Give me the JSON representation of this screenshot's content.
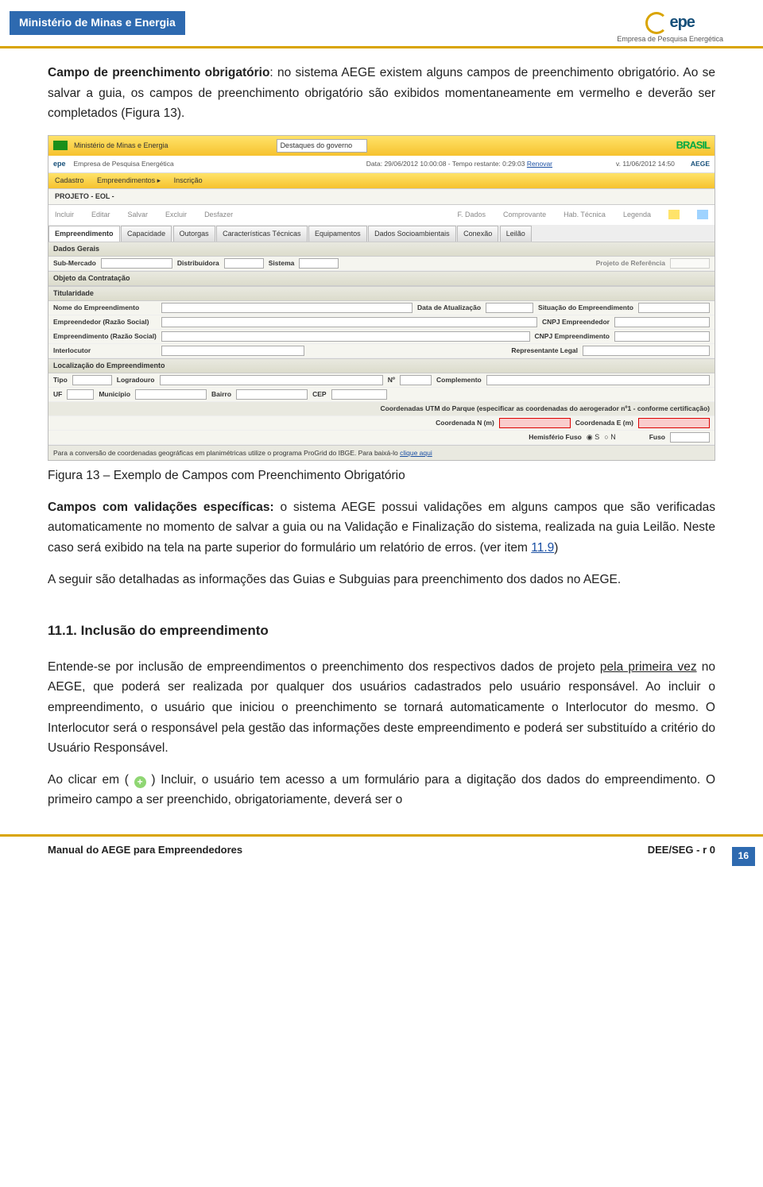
{
  "header": {
    "ministry": "Ministério de Minas e Energia",
    "logo_text": "epe",
    "logo_sub": "Empresa de Pesquisa Energética"
  },
  "para1_lead": "Campo de preenchimento obrigatório",
  "para1_rest": ": no sistema AEGE existem alguns campos de preenchimento obrigatório. Ao se salvar a guia, os campos de preenchimento obrigatório são exibidos momentaneamente em vermelho e deverão ser completados (Figura 13).",
  "caption": "Figura 13 – Exemplo de Campos com Preenchimento Obrigatório",
  "para2_lead": "Campos com validações específicas:",
  "para2_rest": " o sistema AEGE possui validações em alguns campos que são verificadas automaticamente no momento de salvar a guia ou na Validação e Finalização do sistema, realizada na guia Leilão. Neste caso será exibido na tela na parte superior do formulário um relatório de erros. (ver item ",
  "para2_link": "11.9",
  "para2_tail": ")",
  "para3": "A seguir são detalhadas as informações das Guias e Subguias para preenchimento dos dados no AEGE.",
  "section_heading": "11.1. Inclusão do empreendimento",
  "para4_a": "Entende-se por inclusão de empreendimentos o preenchimento dos respectivos dados de projeto ",
  "para4_u": "pela primeira vez",
  "para4_b": " no AEGE, que poderá ser realizada por qualquer dos usuários cadastrados pelo usuário responsável. Ao incluir o empreendimento, o usuário que iniciou o preenchimento se tornará automaticamente o Interlocutor do mesmo. O Interlocutor será o responsável pela gestão das informações deste empreendimento e poderá ser substituído a critério do Usuário Responsável.",
  "para5_a": "Ao clicar em ( ",
  "para5_b": " ) Incluir, o usuário tem acesso a um formulário para a digitação dos dados do empreendimento. O primeiro campo a ser preenchido, obrigatoriamente, deverá ser o",
  "page_number": "16",
  "footer_left": "Manual do AEGE para Empreendedores",
  "footer_right": "DEE/SEG - r 0",
  "shot": {
    "gov_label": "Ministério de Minas e Energia",
    "destaques": "Destaques do governo",
    "brasil": "BRASIL",
    "epe": "epe",
    "epe_sub": "Empresa de Pesquisa Energética",
    "data_line": "Data: 29/06/2012 10:00:08 - Tempo restante: 0:29:03 ",
    "renovar": "Renovar",
    "date_right": "v. 11/06/2012 14:50",
    "aege": "AEGE",
    "menu": {
      "cadastro": "Cadastro",
      "emp": "Empreendimentos ▸",
      "insc": "Inscrição"
    },
    "proj": "PROJETO - EOL -",
    "tools": {
      "incluir": "Incluir",
      "editar": "Editar",
      "salvar": "Salvar",
      "excluir": "Excluir",
      "desfazer": "Desfazer",
      "fdados": "F. Dados",
      "comprov": "Comprovante",
      "hab": "Hab. Técnica",
      "legenda": "Legenda"
    },
    "tabs": [
      "Empreendimento",
      "Capacidade",
      "Outorgas",
      "Características Técnicas",
      "Equipamentos",
      "Dados Socioambientais",
      "Conexão",
      "Leilão"
    ],
    "sec_dados": "Dados Gerais",
    "labels": {
      "submercado": "Sub-Mercado",
      "distrib": "Distribuidora",
      "sistema": "Sistema",
      "projref": "Projeto de Referência",
      "objeto": "Objeto da Contratação",
      "titularidade": "Titularidade",
      "nome": "Nome do Empreendimento",
      "dataatu": "Data de Atualização",
      "situacao": "Situação do Empreendimento",
      "emp_razao": "Empreendedor (Razão Social)",
      "cnpj_emp": "CNPJ Empreendedor",
      "emp_razao2": "Empreendimento (Razão Social)",
      "cnpj_emp2": "CNPJ Empreendimento",
      "interlocutor": "Interlocutor",
      "replegal": "Representante Legal"
    },
    "sec_loc": "Localização do Empreendimento",
    "loc": {
      "tipo": "Tipo",
      "logradouro": "Logradouro",
      "n": "Nº",
      "complemento": "Complemento",
      "uf": "UF",
      "municipio": "Município",
      "bairro": "Bairro",
      "cep": "CEP"
    },
    "coord_head": "Coordenadas UTM do Parque (especificar as coordenadas do aerogerador nº1 - conforme certificação)",
    "coord_n": "Coordenada N (m)",
    "coord_e": "Coordenada E (m)",
    "hemisf": "Hemisfério Fuso",
    "radio_s": "S",
    "radio_n": "N",
    "fuso": "Fuso",
    "footnote": "Para a conversão de coordenadas geográficas em planimétricas utilize o programa ProGrid do IBGE. Para baixá-lo ",
    "clique": "clique aqui"
  }
}
